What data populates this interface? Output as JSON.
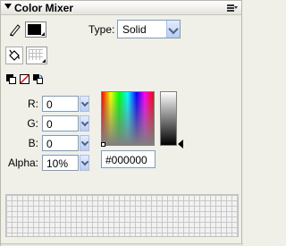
{
  "panel": {
    "title": "Color Mixer",
    "icons": {
      "collapse": "collapse-arrow-icon",
      "options": "options-menu-icon",
      "stroke": "pencil-icon",
      "fill": "paint-bucket-icon",
      "black_white": "black-white-icon",
      "no_color": "no-color-icon",
      "swap": "swap-colors-icon"
    }
  },
  "controls": {
    "type_label": "Type:",
    "type_value": "Solid",
    "stroke_color": "#000000"
  },
  "rgb": [
    {
      "label": "R:",
      "value": "0"
    },
    {
      "label": "G:",
      "value": "0"
    },
    {
      "label": "B:",
      "value": "0"
    }
  ],
  "alpha": {
    "label": "Alpha:",
    "value": "10%"
  },
  "hex": {
    "value": "#000000"
  },
  "colors": {
    "panel_bg": "#f0efe8",
    "input_border": "#7f9db9",
    "accent": "#4d6185"
  }
}
